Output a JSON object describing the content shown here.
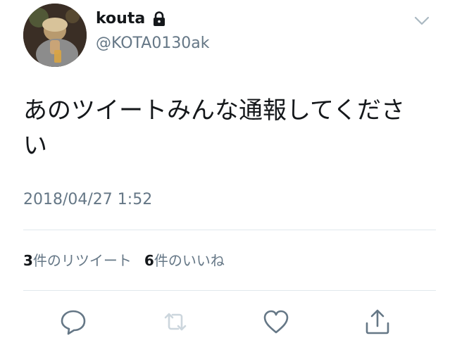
{
  "user": {
    "display_name": "kouta",
    "handle": "@KOTA0130ak",
    "protected": true
  },
  "tweet": {
    "text": "あのツイートみんな通報してください",
    "timestamp": "2018/04/27 1:52"
  },
  "stats": {
    "retweets_count": "3",
    "retweets_label": "件のリツイート",
    "likes_count": "6",
    "likes_label": "件のいいね"
  },
  "actions": [
    {
      "icon": "reply-icon"
    },
    {
      "icon": "retweet-icon"
    },
    {
      "icon": "like-icon"
    },
    {
      "icon": "share-icon"
    }
  ],
  "colors": {
    "text": "#14171a",
    "secondary": "#657786",
    "divider": "#e1e8ed",
    "icon": "#657786",
    "icon_disabled": "#ccd6dd"
  }
}
